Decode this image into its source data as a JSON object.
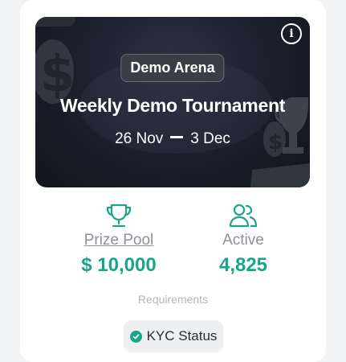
{
  "banner": {
    "badge": "Demo Arena",
    "title": "Weekly Demo Tournament",
    "start_date": "26 Nov",
    "end_date": "3 Dec",
    "info_icon": "info-icon"
  },
  "stats": {
    "prize": {
      "icon": "trophy-icon",
      "label": "Prize Pool",
      "value": "$ 10,000"
    },
    "active": {
      "icon": "users-icon",
      "label": "Active",
      "value": "4,825"
    }
  },
  "requirements": {
    "label": "Requirements",
    "items": [
      {
        "icon": "check-circle-icon",
        "label": "KYC Status"
      }
    ]
  },
  "colors": {
    "accent": "#1aa58a",
    "banner_bg": "#1b1e2b",
    "muted_text": "#8c909a"
  }
}
